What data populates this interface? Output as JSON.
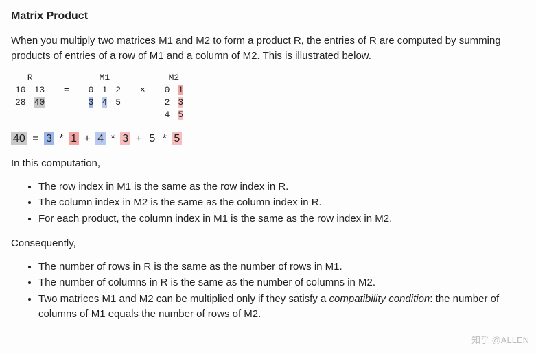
{
  "title": "Matrix Product",
  "intro": "When you multiply two matrices M1 and M2 to form a product R, the entries of R are computed by summing products of entries of a row of M1 and a column of M2. This is illustrated below.",
  "mat": {
    "R": {
      "label": "R",
      "rows": [
        [
          "10",
          "13"
        ],
        [
          "28",
          "40"
        ]
      ]
    },
    "M1": {
      "label": "M1",
      "rows": [
        [
          "0",
          "1",
          "2"
        ],
        [
          "3",
          "4",
          "5"
        ]
      ]
    },
    "M2": {
      "label": "M2",
      "rows": [
        [
          "0",
          "1"
        ],
        [
          "2",
          "3"
        ],
        [
          "4",
          "5"
        ]
      ]
    },
    "eq": "=",
    "times": "×"
  },
  "equation": {
    "lhs": "40",
    "eq1": " = ",
    "a1": "3",
    "op1": " * ",
    "b1": "1",
    "plus1": " + ",
    "a2": "4",
    "op2": " * ",
    "b2": "3",
    "plus2": " + ",
    "a3": "5",
    "op3": " * ",
    "b3": "5"
  },
  "para_comp": "In this computation,",
  "list1": {
    "i0": "The row index in M1 is the same as the row index in R.",
    "i1": "The column index in M2 is the same as the column index in R.",
    "i2": "For each product, the column index in M1 is the same as the row index in M2."
  },
  "para_cons": "Consequently,",
  "list2": {
    "i0": "The number of rows in R is the same as the number of rows in M1.",
    "i1": "The number of columns in R is the same as the number of columns in M2.",
    "i2a": "Two matrices M1 and M2 can be multiplied only if they satisfy a ",
    "i2b": "compatibility condition",
    "i2c": ": the number of columns of M1 equals the number of rows of M2."
  },
  "watermark": "知乎 @ALLEN"
}
